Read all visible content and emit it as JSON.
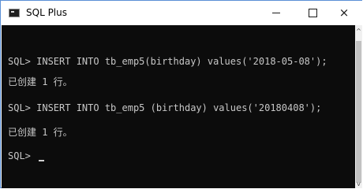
{
  "window": {
    "title": "SQL Plus",
    "icon": "console-app-icon",
    "controls": {
      "minimize_icon": "minimize-icon",
      "maximize_icon": "maximize-icon",
      "close_icon": "close-icon",
      "close_glyph": "×"
    }
  },
  "console": {
    "background": "#0c0c0c",
    "text_color": "#c7c7c7",
    "lines": [
      "SQL> INSERT INTO tb_emp5(birthday) values('2018-05-08');",
      "已创建 1 行。",
      "SQL> INSERT INTO tb_emp5 (birthday) values('20180408');",
      "已创建 1 行。",
      "SQL> "
    ]
  },
  "scrollbar": {
    "up_glyph": "^",
    "down_glyph": "v"
  }
}
